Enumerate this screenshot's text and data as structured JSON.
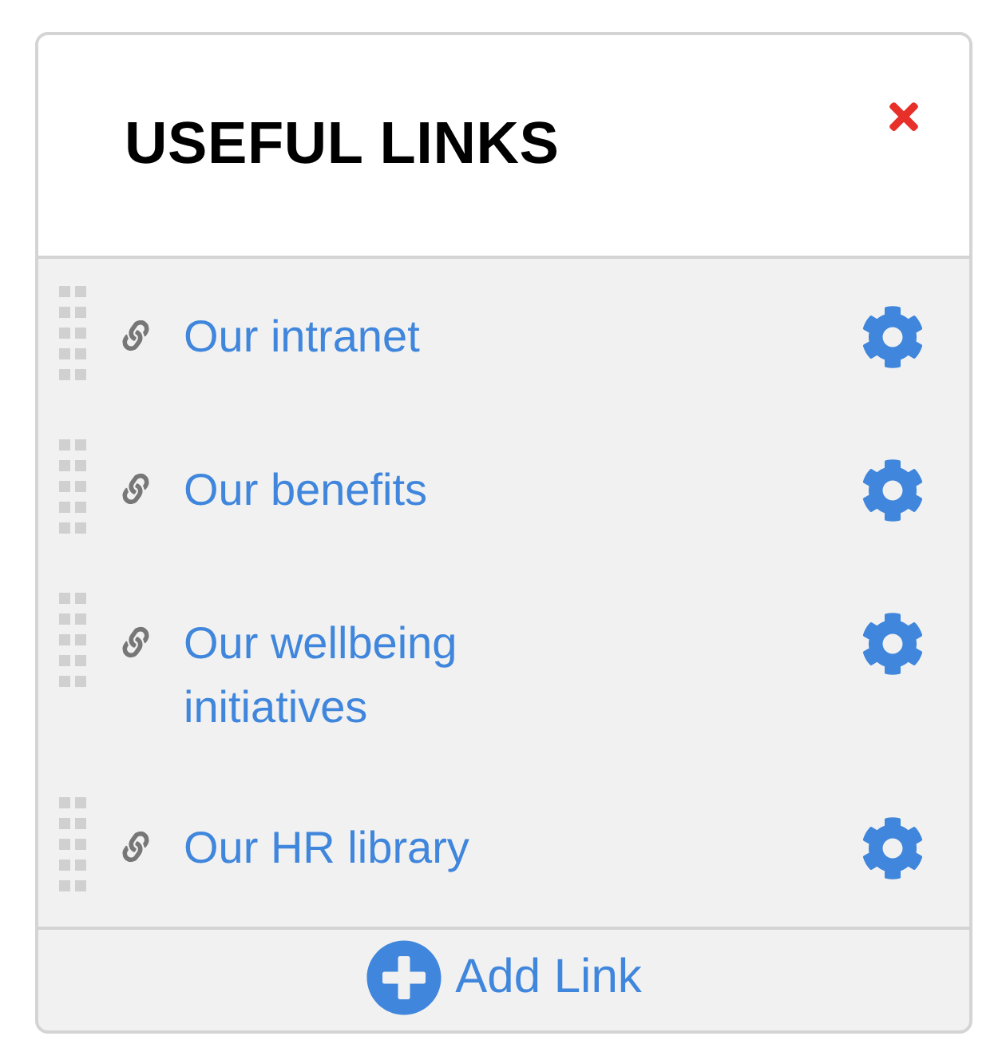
{
  "panel": {
    "title": "USEFUL LINKS"
  },
  "links": [
    {
      "label": "Our intranet"
    },
    {
      "label": "Our benefits"
    },
    {
      "label": "Our wellbeing initiatives"
    },
    {
      "label": "Our HR library"
    }
  ],
  "footer": {
    "add_button": "Add Link"
  }
}
